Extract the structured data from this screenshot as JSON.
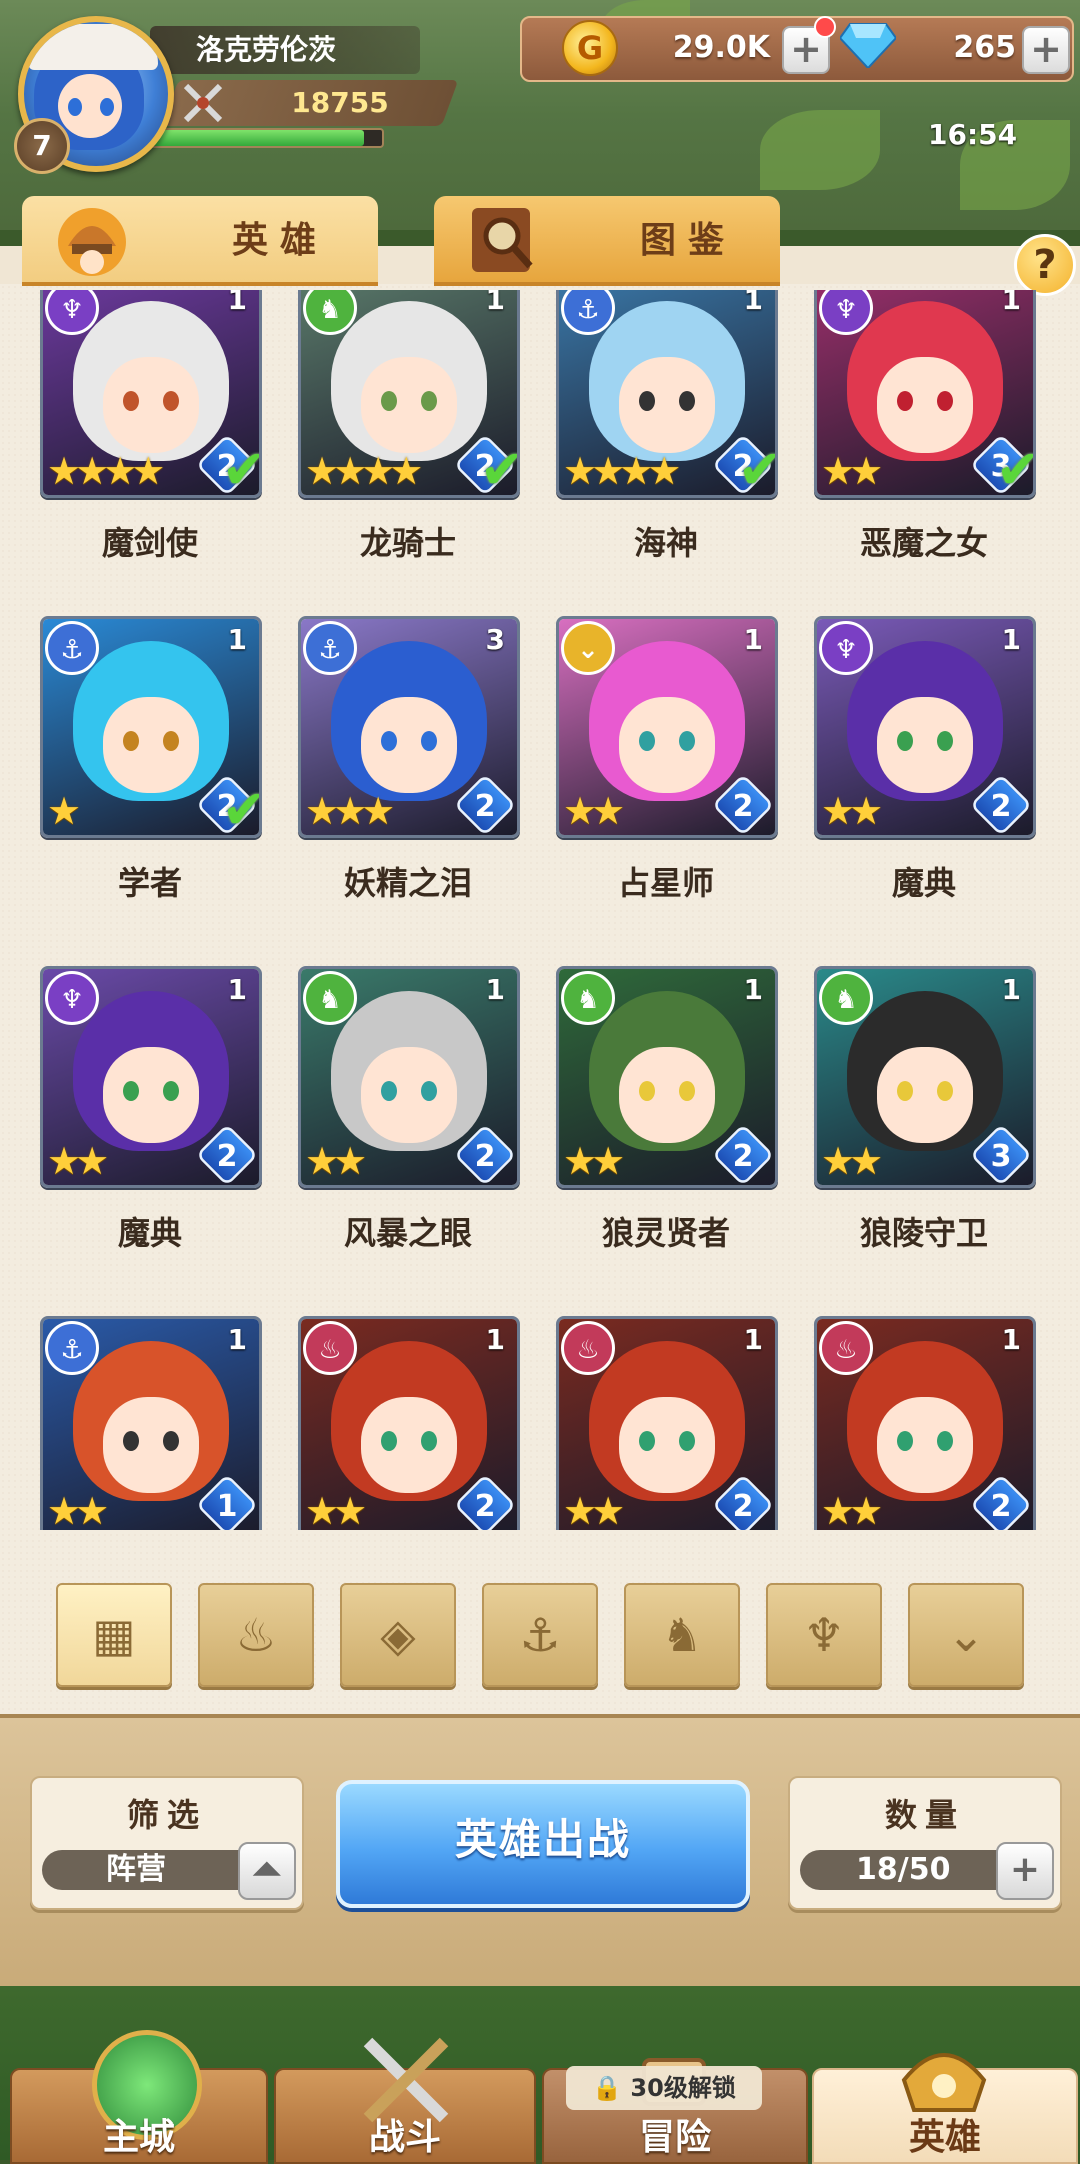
{
  "player": {
    "name": "洛克劳伦茨",
    "level": "7",
    "power": "18755",
    "exp_fraction": 0.92
  },
  "resources": {
    "gold": "29.0K",
    "gems": "265",
    "time": "16:54"
  },
  "tabs": [
    {
      "label": "英雄",
      "active": true
    },
    {
      "label": "图鉴",
      "active": false
    }
  ],
  "help_label": "?",
  "colors": {
    "anchor": "#3d6fd6",
    "dragon": "#4fb33e",
    "demon": "#7a3fc4",
    "star": "#e8b42a",
    "flame": "#c23a5a"
  },
  "heroes": [
    {
      "name": "魔剑使",
      "faction": "demon",
      "count": "1",
      "stars": "★★★★",
      "rank": "2",
      "check": true,
      "hair": "#e8e8e8",
      "bg": "#6e3aa0",
      "eye": "#c0542b"
    },
    {
      "name": "龙骑士",
      "faction": "dragon",
      "count": "1",
      "stars": "★★★★",
      "rank": "2",
      "check": true,
      "hair": "#e6e6e6",
      "bg": "#5a7a6a",
      "eye": "#6a9a4a"
    },
    {
      "name": "海神",
      "faction": "anchor",
      "count": "1",
      "stars": "★★★★",
      "rank": "2",
      "check": true,
      "hair": "#9fd4f2",
      "bg": "#3a78a8",
      "eye": "#333"
    },
    {
      "name": "恶魔之女",
      "faction": "demon",
      "count": "1",
      "stars": "★★",
      "rank": "3",
      "check": true,
      "hair": "#e0384f",
      "bg": "#9a2f6a",
      "eye": "#c02030"
    },
    {
      "name": "学者",
      "faction": "anchor",
      "count": "1",
      "stars": "★",
      "rank": "2",
      "check": true,
      "hair": "#34c4ee",
      "bg": "#2a8ad6",
      "eye": "#c48320"
    },
    {
      "name": "妖精之泪",
      "faction": "anchor",
      "count": "3",
      "stars": "★★★",
      "rank": "2",
      "check": false,
      "hair": "#2b5ed0",
      "bg": "#8a78c8",
      "eye": "#2d6fd8"
    },
    {
      "name": "占星师",
      "faction": "star",
      "count": "1",
      "stars": "★★",
      "rank": "2",
      "check": false,
      "hair": "#e85ad0",
      "bg": "#d86fc0",
      "eye": "#30a0a0"
    },
    {
      "name": "魔典",
      "faction": "demon",
      "count": "1",
      "stars": "★★",
      "rank": "2",
      "check": false,
      "hair": "#5a2fa8",
      "bg": "#7a5ab8",
      "eye": "#3aa050"
    },
    {
      "name": "魔典",
      "faction": "demon",
      "count": "1",
      "stars": "★★",
      "rank": "2",
      "check": false,
      "hair": "#5a2fa8",
      "bg": "#6a4aa8",
      "eye": "#3aa050"
    },
    {
      "name": "风暴之眼",
      "faction": "dragon",
      "count": "1",
      "stars": "★★",
      "rank": "2",
      "check": false,
      "hair": "#c8c8c8",
      "bg": "#3a7a6a",
      "eye": "#30a0a0"
    },
    {
      "name": "狼灵贤者",
      "faction": "dragon",
      "count": "1",
      "stars": "★★",
      "rank": "2",
      "check": false,
      "hair": "#4a7a3a",
      "bg": "#2f6a3a",
      "eye": "#e8c83a"
    },
    {
      "name": "狼陵守卫",
      "faction": "dragon",
      "count": "1",
      "stars": "★★",
      "rank": "3",
      "check": false,
      "hair": "#2b2b2b",
      "bg": "#2a8a8a",
      "eye": "#e8c83a"
    },
    {
      "name": "",
      "faction": "anchor",
      "count": "1",
      "stars": "★★",
      "rank": "1",
      "check": false,
      "hair": "#d8532a",
      "bg": "#2a5aa8",
      "eye": "#333"
    },
    {
      "name": "",
      "faction": "flame",
      "count": "1",
      "stars": "★★",
      "rank": "2",
      "check": false,
      "hair": "#c23a22",
      "bg": "#7a2a20",
      "eye": "#30a070"
    },
    {
      "name": "",
      "faction": "flame",
      "count": "1",
      "stars": "★★",
      "rank": "2",
      "check": false,
      "hair": "#c23a22",
      "bg": "#7a2a20",
      "eye": "#30a070"
    },
    {
      "name": "",
      "faction": "flame",
      "count": "1",
      "stars": "★★",
      "rank": "2",
      "check": false,
      "hair": "#c23a22",
      "bg": "#7a2a20",
      "eye": "#30a070"
    }
  ],
  "faction_filters": [
    {
      "icon": "grid-icon",
      "glyph": "▦",
      "active": true
    },
    {
      "icon": "flame-faction-icon",
      "glyph": "♨",
      "active": false
    },
    {
      "icon": "diamond-faction-icon",
      "glyph": "◈",
      "active": false
    },
    {
      "icon": "anchor-faction-icon",
      "glyph": "⚓",
      "active": false
    },
    {
      "icon": "dragon-faction-icon",
      "glyph": "♞",
      "active": false
    },
    {
      "icon": "demon-faction-icon",
      "glyph": "♆",
      "active": false
    },
    {
      "icon": "star-faction-icon",
      "glyph": "⌄",
      "active": false
    }
  ],
  "filter": {
    "title": "筛选",
    "value": "阵营"
  },
  "deploy_label": "英雄出战",
  "capacity": {
    "title": "数量",
    "value": "18/50"
  },
  "nav": [
    {
      "label": "主城",
      "active": false
    },
    {
      "label": "战斗",
      "active": false
    },
    {
      "label": "冒险",
      "active": false
    },
    {
      "label": "英雄",
      "active": true
    }
  ],
  "adventure_lock": "30级解锁"
}
